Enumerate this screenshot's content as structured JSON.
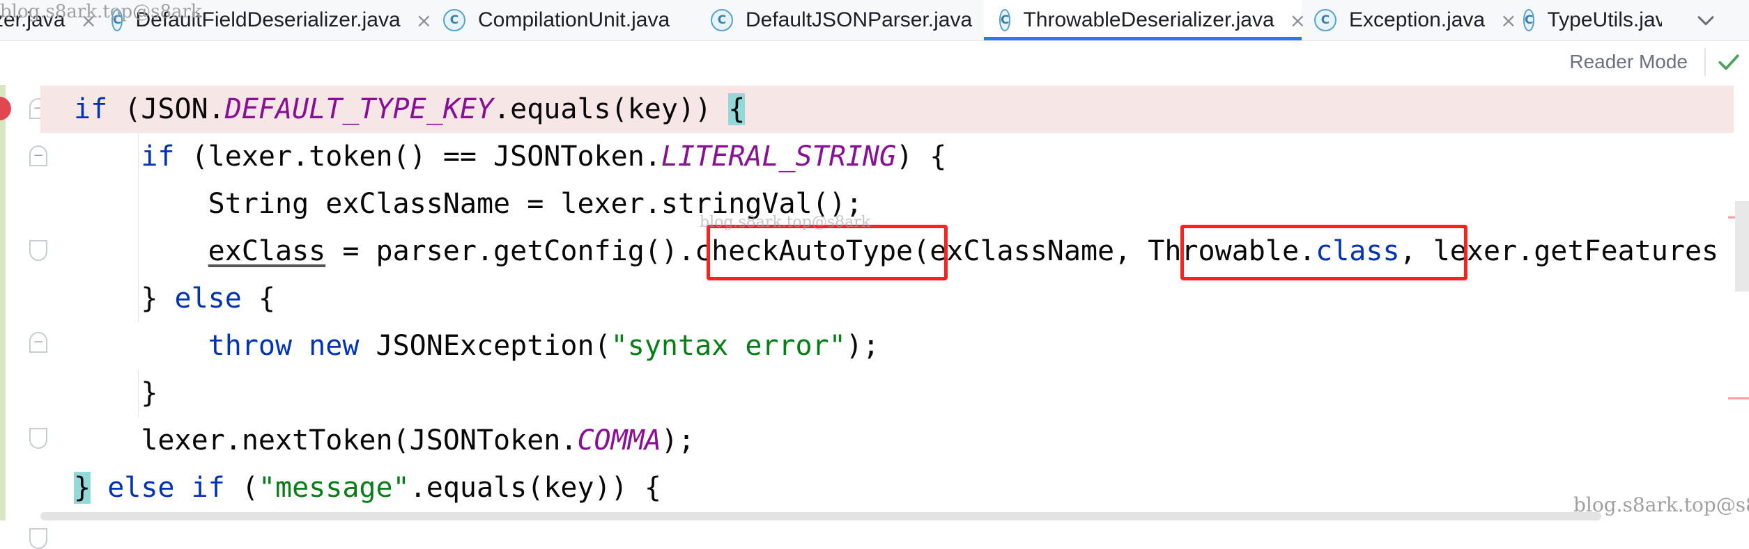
{
  "tabs": [
    {
      "label": "zer.java",
      "icon": "class-icon",
      "active": false
    },
    {
      "label": "DefaultFieldDeserializer.java",
      "icon": "class-icon",
      "active": false
    },
    {
      "label": "CompilationUnit.java",
      "icon": "class-icon",
      "active": false
    },
    {
      "label": "DefaultJSONParser.java",
      "icon": "class-icon",
      "active": false
    },
    {
      "label": "ThrowableDeserializer.java",
      "icon": "class-icon",
      "active": true
    },
    {
      "label": "Exception.java",
      "icon": "class-icon",
      "active": false
    },
    {
      "label": "TypeUtils.jav",
      "icon": "class-icon",
      "active": false
    }
  ],
  "tab_icon_letter": "C",
  "tab_close_glyph": "×",
  "reader_mode": "Reader Mode",
  "watermark": "blog.s8ark.top@s8ark",
  "code": {
    "l1": {
      "a": "if",
      "b": " (JSON.",
      "c": "DEFAULT_TYPE_KEY",
      "d": ".equals(key)) ",
      "e": "{"
    },
    "l2": {
      "a": "    ",
      "b": "if",
      "c": " (lexer.token() == JSONToken.",
      "d": "LITERAL_STRING",
      "e": ") {"
    },
    "l3": {
      "a": "        String exClassName = lexer.stringVal();"
    },
    "l4": {
      "a": "        ",
      "b": "exClass",
      "c": " = parser.getConfig().",
      "d": "checkAutoType",
      "e": "(exClassName, ",
      "f": "Throwable.",
      "g": "class",
      "h": ",",
      "i": " lexer.getFeatures"
    },
    "l5": {
      "a": "    } ",
      "b": "else",
      "c": " {"
    },
    "l6": {
      "a": "        ",
      "b": "throw",
      "c": " ",
      "d": "new",
      "e": " JSONException(",
      "f": "\"syntax error\"",
      "g": ");"
    },
    "l7": {
      "a": "    }"
    },
    "l8": {
      "a": "    lexer.nextToken(JSONToken.",
      "b": "COMMA",
      "c": ");"
    },
    "l9": {
      "a": "}",
      "b": " ",
      "c": "else if",
      "d": " (",
      "e": "\"message\"",
      "f": ".equals(key)) {"
    }
  },
  "colors": {
    "keyword": "#0033b3",
    "field": "#871094",
    "string": "#067d17",
    "highlight_line": "#f7e6e6",
    "brace_match": "#93d9d9",
    "annotation_box": "#ff2020",
    "active_tab_underline": "#3574f0",
    "breakpoint": "#e0474f"
  }
}
